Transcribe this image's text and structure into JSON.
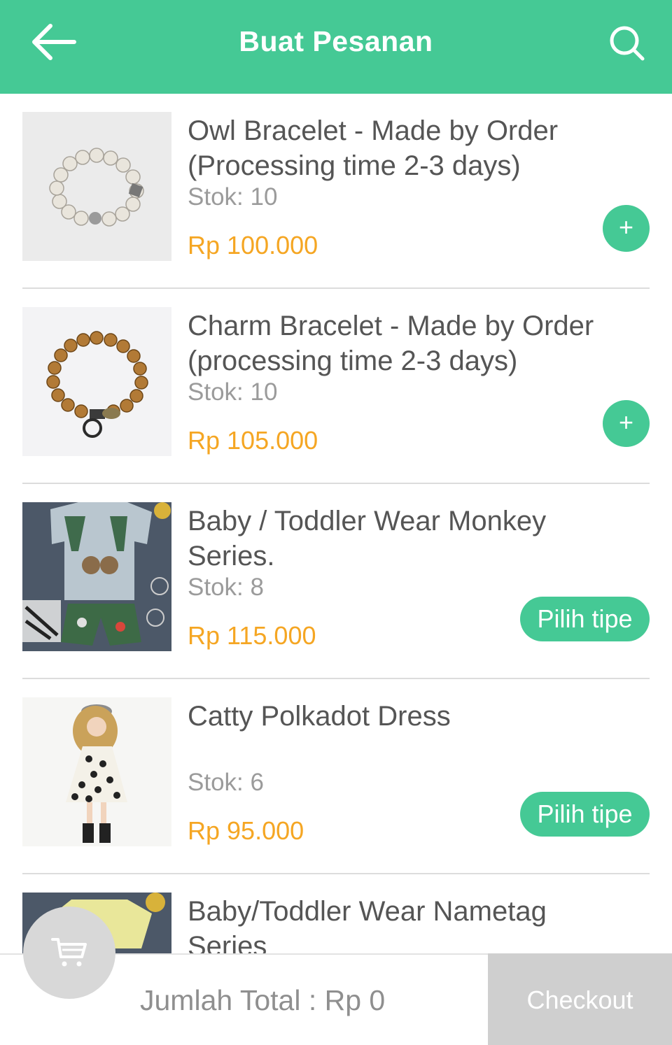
{
  "header": {
    "title": "Buat Pesanan",
    "back_icon": "arrow-left-icon",
    "search_icon": "search-icon",
    "background": "#45c995"
  },
  "products": [
    {
      "name_line1": "Owl Bracelet - Made by Order",
      "name_line2": "(Processing time 2-3 days)",
      "stock": "Stok: 10",
      "price": "Rp 100.000",
      "action": "+"
    },
    {
      "name_line1": "Charm Bracelet - Made by Order",
      "name_line2": "(processing time 2-3 days)",
      "stock": "Stok: 10",
      "price": "Rp 105.000",
      "action": "+"
    },
    {
      "name_line1": "Baby / Toddler Wear Monkey",
      "name_line2": "Series.",
      "stock": "Stok: 8",
      "price": "Rp 115.000",
      "action": "Pilih tipe"
    },
    {
      "name_line1": "Catty Polkadot Dress",
      "name_line2": "",
      "stock": "Stok: 6",
      "price": "Rp 95.000",
      "action": "Pilih tipe"
    },
    {
      "name_line1": "Baby/Toddler Wear Nametag",
      "name_line2": "Series"
    }
  ],
  "footer": {
    "total": "Jumlah Total : Rp 0",
    "checkout": "Checkout",
    "cart_icon": "cart-icon"
  },
  "colors": {
    "accent": "#45c995",
    "price": "#f5a623",
    "disabled": "#cfcfcf"
  }
}
